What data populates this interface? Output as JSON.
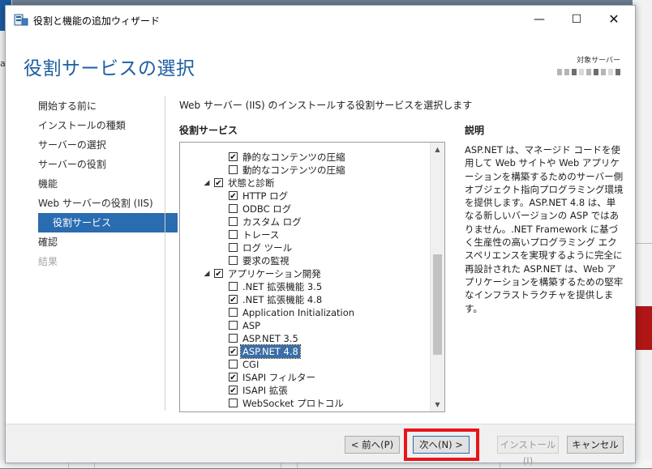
{
  "window": {
    "title": "役割と機能の追加ウィザード",
    "controls": {
      "minimize": "—",
      "maximize": "☐",
      "close": "✕"
    }
  },
  "page_title": "役割サービスの選択",
  "destination": {
    "label": "対象サーバー"
  },
  "background": {
    "left_text": "a"
  },
  "nav": {
    "items": [
      {
        "label": "開始する前に",
        "state": "normal"
      },
      {
        "label": "インストールの種類",
        "state": "normal"
      },
      {
        "label": "サーバーの選択",
        "state": "normal"
      },
      {
        "label": "サーバーの役割",
        "state": "normal"
      },
      {
        "label": "機能",
        "state": "normal"
      },
      {
        "label": "Web サーバーの役割 (IIS)",
        "state": "normal"
      },
      {
        "label": "役割サービス",
        "state": "selected"
      },
      {
        "label": "確認",
        "state": "normal"
      },
      {
        "label": "結果",
        "state": "disabled"
      }
    ]
  },
  "intro": "Web サーバー (IIS) のインストールする役割サービスを選択します",
  "services_heading": "役割サービス",
  "description": {
    "heading": "説明",
    "text": "ASP.NET は、マネージド コードを使用して Web サイトや Web アプリケーションを構築するためのサーバー側オブジェクト指向プログラミング環境を提供します。ASP.NET 4.8 は、単なる新しいバージョンの ASP ではありません。.NET Framework に基づく生産性の高いプログラミング エクスペリエンスを実現するように完全に再設計された ASP.NET は、Web アプリケーションを構築するための堅牢なインフラストラクチャを提供します。"
  },
  "tree": {
    "check_glyph": "✔",
    "expander_glyph": "◢",
    "items": [
      {
        "label": "静的なコンテンツの圧縮",
        "checked": true,
        "level": 2
      },
      {
        "label": "動的なコンテンツの圧縮",
        "checked": false,
        "level": 2
      },
      {
        "label": "状態と診断",
        "checked": true,
        "level": 1,
        "expanded": true
      },
      {
        "label": "HTTP ログ",
        "checked": true,
        "level": 2
      },
      {
        "label": "ODBC ログ",
        "checked": false,
        "level": 2
      },
      {
        "label": "カスタム ログ",
        "checked": false,
        "level": 2
      },
      {
        "label": "トレース",
        "checked": false,
        "level": 2
      },
      {
        "label": "ログ ツール",
        "checked": false,
        "level": 2
      },
      {
        "label": "要求の監視",
        "checked": false,
        "level": 2
      },
      {
        "label": "アプリケーション開発",
        "checked": true,
        "level": 1,
        "expanded": true
      },
      {
        "label": ".NET 拡張機能 3.5",
        "checked": false,
        "level": 2
      },
      {
        "label": ".NET 拡張機能 4.8",
        "checked": true,
        "level": 2
      },
      {
        "label": "Application Initialization",
        "checked": false,
        "level": 2
      },
      {
        "label": "ASP",
        "checked": false,
        "level": 2
      },
      {
        "label": "ASP.NET 3.5",
        "checked": false,
        "level": 2
      },
      {
        "label": "ASP.NET 4.8",
        "checked": true,
        "level": 2,
        "selected": true
      },
      {
        "label": "CGI",
        "checked": false,
        "level": 2
      },
      {
        "label": "ISAPI フィルター",
        "checked": true,
        "level": 2
      },
      {
        "label": "ISAPI 拡張",
        "checked": true,
        "level": 2
      },
      {
        "label": "WebSocket プロトコル",
        "checked": false,
        "level": 2
      }
    ],
    "scroll": {
      "up": "▲",
      "down": "▼"
    }
  },
  "buttons": {
    "prev": "< 前へ(P)",
    "next": "次へ(N) >",
    "install": "インストール(I)",
    "cancel": "キャンセル"
  },
  "colors": {
    "accent": "#1c5fa0",
    "selection": "#2a6cb0",
    "highlight_frame": "#e8141a"
  }
}
